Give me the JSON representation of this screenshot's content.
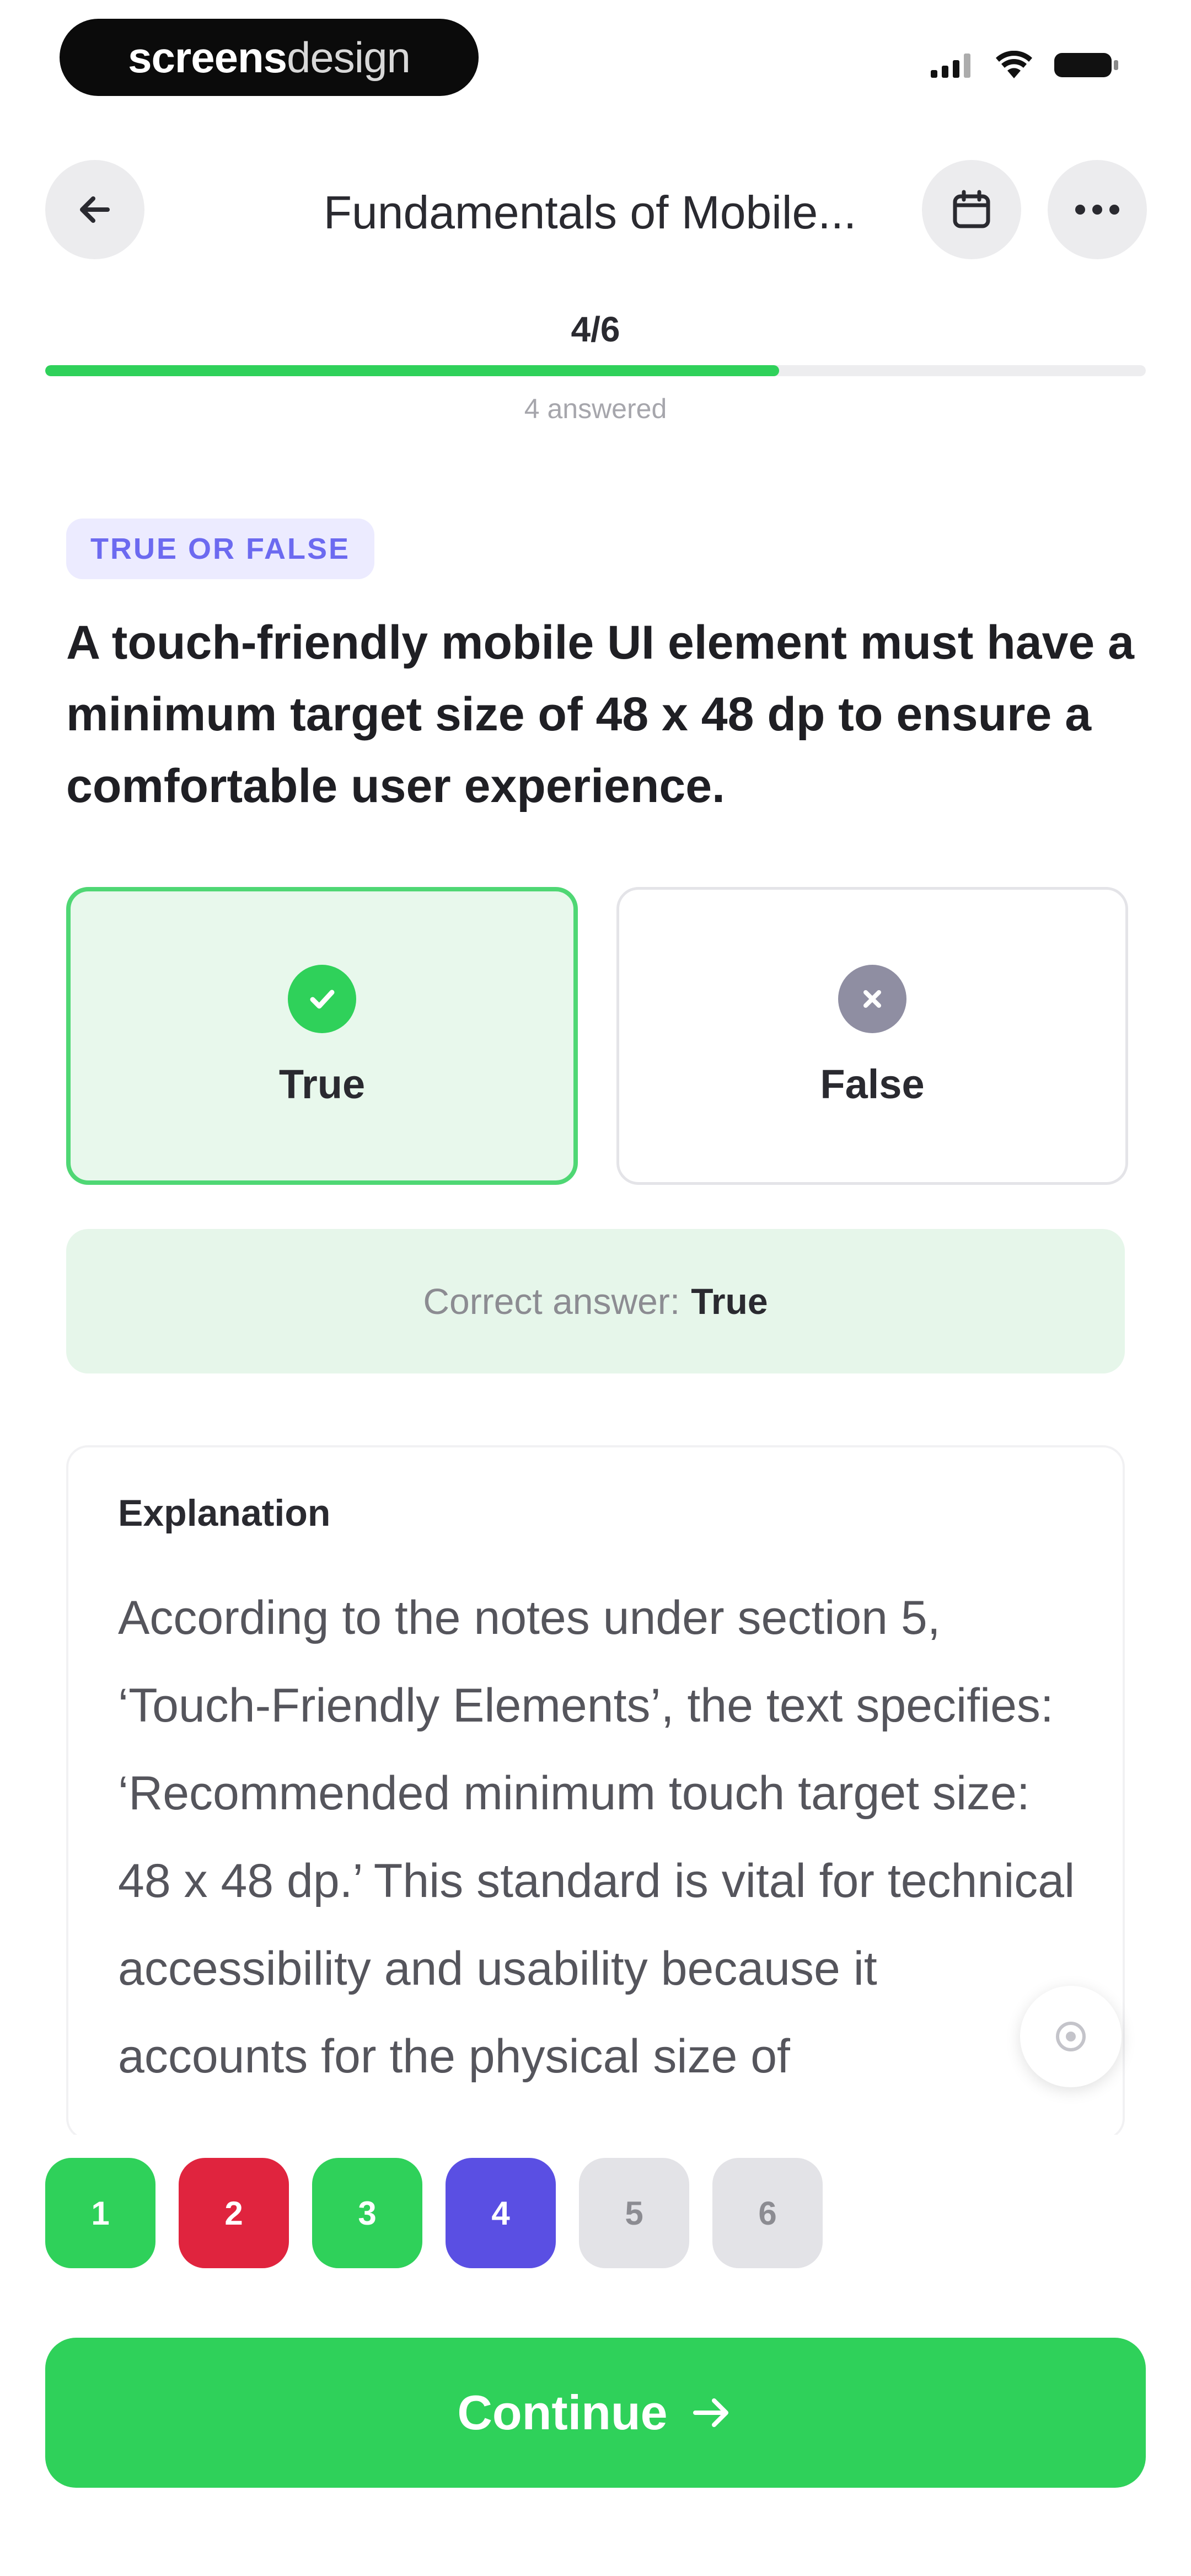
{
  "status_bar": {
    "brand_bold": "screens",
    "brand_light": "design"
  },
  "header": {
    "title": "Fundamentals of Mobile...",
    "icons": [
      "back-arrow-icon",
      "calendar-icon",
      "more-icon"
    ]
  },
  "progress": {
    "label": "4/6",
    "answered": "4 answered",
    "fraction": 0.6667
  },
  "question": {
    "type_tag": "TRUE OR FALSE",
    "text": "A touch-friendly mobile UI element must have a minimum target size of 48 x 48 dp to ensure a comfortable user experience."
  },
  "options": [
    {
      "label": "True",
      "state": "selected-correct",
      "icon": "check-circle-icon"
    },
    {
      "label": "False",
      "state": "unselected",
      "icon": "x-circle-icon"
    }
  ],
  "correct_answer": {
    "prefix": "Correct answer:",
    "value": "True"
  },
  "explanation": {
    "title": "Explanation",
    "body": "According to the notes under section 5, ‘Touch-Friendly Elements’, the text specifies: ‘Recommended minimum touch target size: 48 x 48 dp.’ This standard is vital for technical accessibility and usability because it accounts for the physical size of"
  },
  "question_nav": [
    {
      "label": "1",
      "state": "correct"
    },
    {
      "label": "2",
      "state": "incorrect"
    },
    {
      "label": "3",
      "state": "correct"
    },
    {
      "label": "4",
      "state": "current"
    },
    {
      "label": "5",
      "state": "unanswered"
    },
    {
      "label": "6",
      "state": "unanswered"
    }
  ],
  "continue_button": {
    "label": "Continue"
  },
  "colors": {
    "accent_green": "#2fd15a",
    "error_red": "#e0243e",
    "current_blue": "#5a4fe3",
    "tag_purple": "#6c6af0"
  }
}
